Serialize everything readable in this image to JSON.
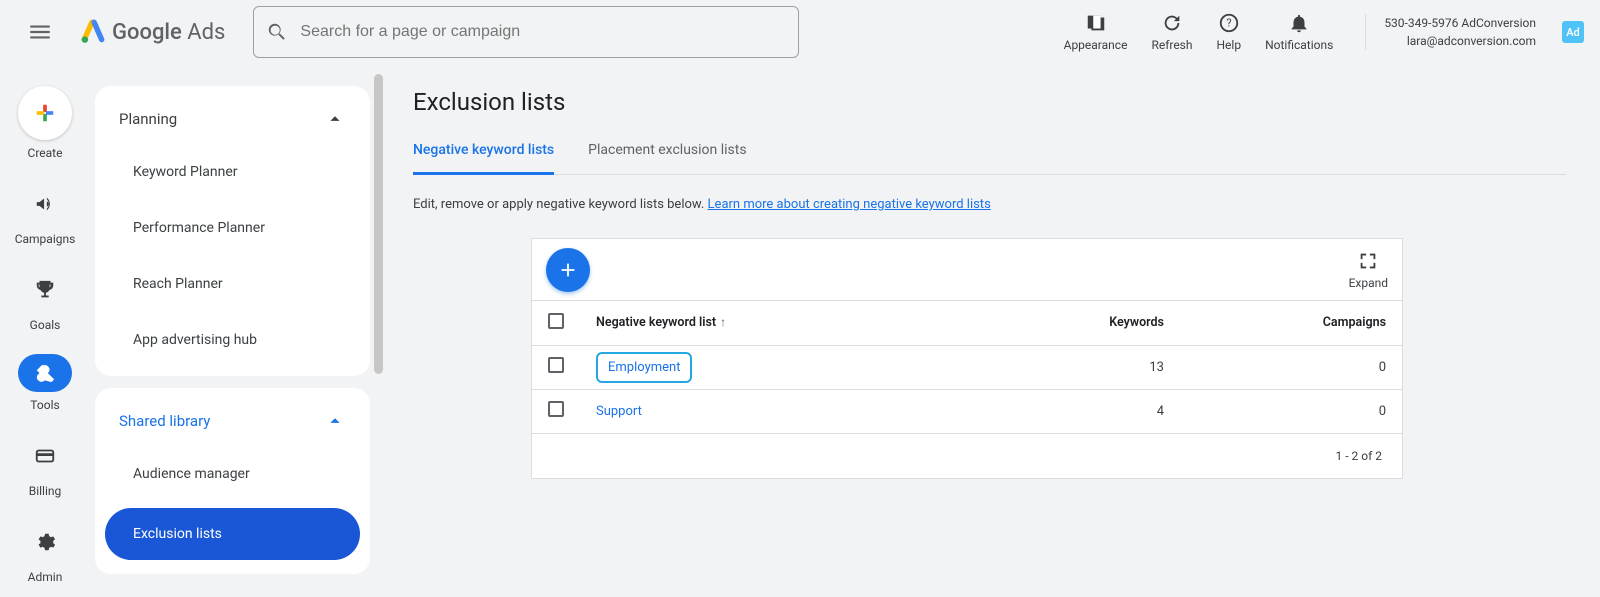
{
  "app": {
    "brand": "Google",
    "product": "Ads"
  },
  "search": {
    "placeholder": "Search for a page or campaign"
  },
  "top_icons": {
    "appearance": "Appearance",
    "refresh": "Refresh",
    "help": "Help",
    "notifications": "Notifications"
  },
  "account": {
    "line1": "530-349-5976 AdConversion",
    "line2": "lara@adconversion.com",
    "badge": "Ad"
  },
  "rail": {
    "create": "Create",
    "campaigns": "Campaigns",
    "goals": "Goals",
    "tools": "Tools",
    "billing": "Billing",
    "admin": "Admin"
  },
  "sidepanel": {
    "planning": {
      "title": "Planning",
      "items": [
        "Keyword Planner",
        "Performance Planner",
        "Reach Planner",
        "App advertising hub"
      ]
    },
    "shared": {
      "title": "Shared library",
      "items": [
        "Audience manager",
        "Exclusion lists"
      ]
    }
  },
  "main": {
    "title": "Exclusion lists",
    "tabs": {
      "negative": "Negative keyword lists",
      "placement": "Placement exclusion lists"
    },
    "hint_text": "Edit, remove or apply negative keyword lists below. ",
    "hint_link": "Learn more about creating negative keyword lists",
    "table": {
      "expand": "Expand",
      "col_name": "Negative keyword list",
      "col_keywords": "Keywords",
      "col_campaigns": "Campaigns",
      "rows": [
        {
          "name": "Employment",
          "keywords": 13,
          "campaigns": 0,
          "highlight": true
        },
        {
          "name": "Support",
          "keywords": 4,
          "campaigns": 0,
          "highlight": false
        }
      ],
      "pager": "1 - 2 of 2"
    }
  }
}
